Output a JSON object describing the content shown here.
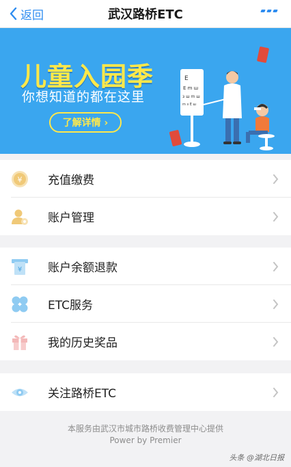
{
  "nav": {
    "back_label": "返回",
    "title": "武汉路桥ETC"
  },
  "banner": {
    "title": "儿童入园季",
    "subtitle": "你想知道的都在这里",
    "button_label": "了解详情 ›"
  },
  "menu_groups": [
    {
      "items": [
        {
          "label": "充值缴费",
          "icon": "coin-icon"
        },
        {
          "label": "账户管理",
          "icon": "user-settings-icon"
        }
      ]
    },
    {
      "items": [
        {
          "label": "账户余额退款",
          "icon": "refund-icon"
        },
        {
          "label": "ETC服务",
          "icon": "clover-icon"
        },
        {
          "label": "我的历史奖品",
          "icon": "gift-icon"
        }
      ]
    },
    {
      "items": [
        {
          "label": "关注路桥ETC",
          "icon": "eye-icon"
        }
      ]
    }
  ],
  "footer": {
    "provider": "本服务由武汉市城市路桥收费管理中心提供",
    "powered_by": "Power by Premier"
  },
  "watermark": "头条 @湖北日报",
  "colors": {
    "accent": "#2f8df0",
    "banner_bg": "#3aa6ef",
    "banner_title": "#ffe84a",
    "coin": "#f0c978",
    "soft_blue": "#8fcbf2",
    "gift_pink": "#f3b8b8"
  }
}
